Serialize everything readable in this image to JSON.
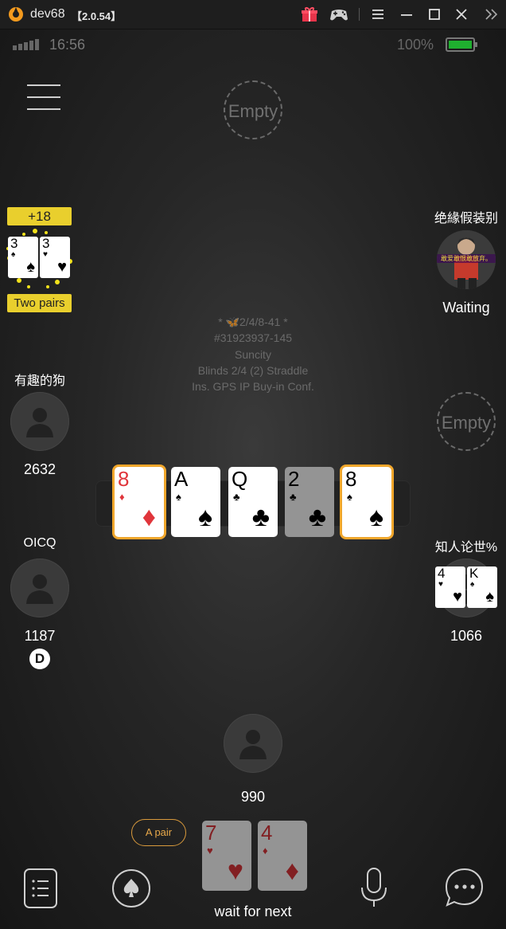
{
  "window": {
    "app_title": "dev68",
    "version": "【2.0.54】"
  },
  "status": {
    "time": "16:56",
    "battery": "100%"
  },
  "seats": {
    "top_empty": "Empty",
    "right_empty": "Empty"
  },
  "left_top_player": {
    "win_amount": "+18",
    "cards": [
      {
        "rank": "3",
        "suit": "♠",
        "color": "#000000"
      },
      {
        "rank": "3",
        "suit": "♥",
        "color": "#e0353b"
      }
    ],
    "hand_label": "Two pairs"
  },
  "right_top_player": {
    "name": "绝緣假装别",
    "status": "Waiting",
    "avatar_banner": "敢爱敢恨敢放弃。"
  },
  "table_info": {
    "line1": "* 🦋2/4/8-41 *",
    "line2": "#31923937-145",
    "line3": "Suncity",
    "line4": "Blinds 2/4 (2) Straddle",
    "line5": "Ins. GPS IP Buy-in Conf."
  },
  "left_mid_player": {
    "name": "有趣的狗",
    "stack": "2632"
  },
  "left_low_player": {
    "name": "OICQ",
    "stack": "1187",
    "dealer": "D"
  },
  "right_low_player": {
    "name": "知人论世%",
    "stack": "1066",
    "cards": [
      {
        "rank": "4",
        "suit": "♥"
      },
      {
        "rank": "K",
        "suit": "♠"
      }
    ]
  },
  "board": [
    {
      "rank": "8",
      "suit": "♦",
      "red": true,
      "highlight": true,
      "dim": false
    },
    {
      "rank": "A",
      "suit": "♠",
      "red": false,
      "highlight": false,
      "dim": false
    },
    {
      "rank": "Q",
      "suit": "♣",
      "red": false,
      "highlight": false,
      "dim": false
    },
    {
      "rank": "2",
      "suit": "♣",
      "red": false,
      "highlight": false,
      "dim": true
    },
    {
      "rank": "8",
      "suit": "♠",
      "red": false,
      "highlight": true,
      "dim": false
    }
  ],
  "hero": {
    "stack": "990",
    "hand_label": "A pair",
    "cards": [
      {
        "rank": "7",
        "suit": "♥"
      },
      {
        "rank": "4",
        "suit": "♦"
      }
    ],
    "status": "wait for next"
  }
}
